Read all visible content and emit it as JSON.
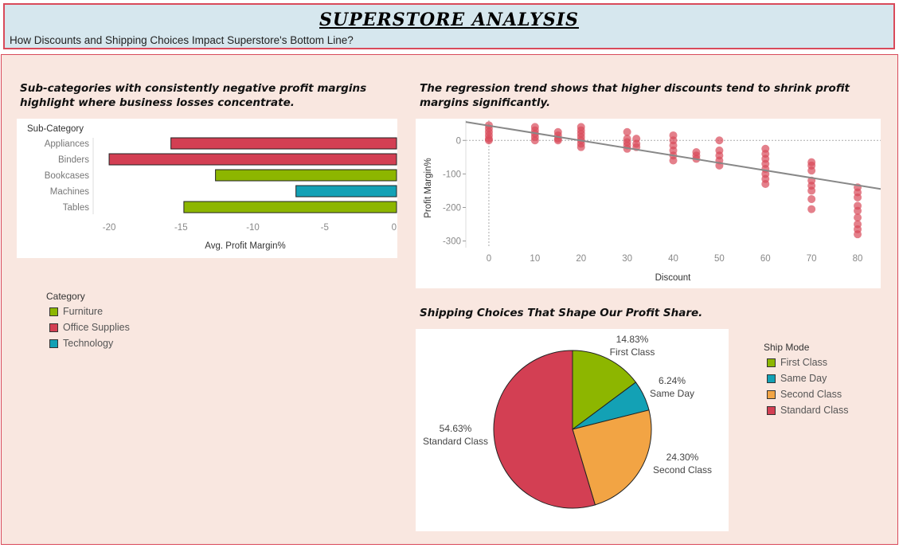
{
  "header": {
    "title": "SUPERSTORE ANALYSIS",
    "subtitle": "How Discounts and Shipping Choices Impact Superstore's Bottom Line?"
  },
  "captions": {
    "bar": "Sub-categories with consistently negative profit margins highlight where business losses concentrate.",
    "scatter": "The regression trend shows that higher discounts tend to shrink profit margins significantly.",
    "pie": "Shipping Choices That Shape Our Profit Share."
  },
  "category_legend": {
    "title": "Category",
    "items": [
      {
        "label": "Furniture",
        "color": "#8db600"
      },
      {
        "label": "Office Supplies",
        "color": "#d33f53"
      },
      {
        "label": "Technology",
        "color": "#13a1b5"
      }
    ]
  },
  "shipmode_legend": {
    "title": "Ship Mode",
    "items": [
      {
        "label": "First Class",
        "color": "#8db600"
      },
      {
        "label": "Same Day",
        "color": "#13a1b5"
      },
      {
        "label": "Second Class",
        "color": "#f2a444"
      },
      {
        "label": "Standard Class",
        "color": "#d33f53"
      }
    ]
  },
  "chart_data": [
    {
      "type": "bar",
      "orientation": "horizontal",
      "row_header": "Sub-Category",
      "categories": [
        "Appliances",
        "Binders",
        "Bookcases",
        "Machines",
        "Tables"
      ],
      "values": [
        -15.7,
        -20.0,
        -12.6,
        -7.0,
        -14.8
      ],
      "colors": [
        "#d33f53",
        "#d33f53",
        "#8db600",
        "#13a1b5",
        "#8db600"
      ],
      "xlabel": "Avg. Profit Margin%",
      "xlim": [
        -21,
        0
      ],
      "xticks": [
        -20,
        -15,
        -10,
        -5,
        0
      ]
    },
    {
      "type": "scatter",
      "xlabel": "Discount",
      "ylabel": "Profit Margin%",
      "xlim": [
        -5,
        85
      ],
      "ylim": [
        -320,
        60
      ],
      "xticks": [
        0,
        10,
        20,
        30,
        40,
        50,
        60,
        70,
        80
      ],
      "yticks": [
        0,
        -100,
        -200,
        -300
      ],
      "color": "#d94a5a",
      "points": [
        [
          0,
          45
        ],
        [
          0,
          35
        ],
        [
          0,
          25
        ],
        [
          0,
          15
        ],
        [
          0,
          5
        ],
        [
          0,
          0
        ],
        [
          10,
          40
        ],
        [
          10,
          30
        ],
        [
          10,
          20
        ],
        [
          10,
          10
        ],
        [
          10,
          0
        ],
        [
          15,
          25
        ],
        [
          15,
          15
        ],
        [
          15,
          5
        ],
        [
          15,
          0
        ],
        [
          20,
          40
        ],
        [
          20,
          30
        ],
        [
          20,
          20
        ],
        [
          20,
          10
        ],
        [
          20,
          0
        ],
        [
          20,
          -10
        ],
        [
          20,
          -20
        ],
        [
          30,
          25
        ],
        [
          30,
          5
        ],
        [
          30,
          -5
        ],
        [
          30,
          -15
        ],
        [
          30,
          -25
        ],
        [
          32,
          5
        ],
        [
          32,
          -10
        ],
        [
          32,
          -20
        ],
        [
          40,
          15
        ],
        [
          40,
          0
        ],
        [
          40,
          -15
        ],
        [
          40,
          -30
        ],
        [
          40,
          -45
        ],
        [
          40,
          -60
        ],
        [
          45,
          -35
        ],
        [
          45,
          -45
        ],
        [
          45,
          -55
        ],
        [
          50,
          0
        ],
        [
          50,
          -30
        ],
        [
          50,
          -45
        ],
        [
          50,
          -60
        ],
        [
          50,
          -75
        ],
        [
          60,
          -25
        ],
        [
          60,
          -40
        ],
        [
          60,
          -55
        ],
        [
          60,
          -70
        ],
        [
          60,
          -85
        ],
        [
          60,
          -100
        ],
        [
          60,
          -115
        ],
        [
          60,
          -130
        ],
        [
          70,
          -65
        ],
        [
          70,
          -75
        ],
        [
          70,
          -90
        ],
        [
          70,
          -120
        ],
        [
          70,
          -135
        ],
        [
          70,
          -150
        ],
        [
          70,
          -175
        ],
        [
          70,
          -205
        ],
        [
          80,
          -140
        ],
        [
          80,
          -155
        ],
        [
          80,
          -170
        ],
        [
          80,
          -195
        ],
        [
          80,
          -210
        ],
        [
          80,
          -230
        ],
        [
          80,
          -250
        ],
        [
          80,
          -265
        ],
        [
          80,
          -280
        ]
      ],
      "trend_line": {
        "x": [
          -5,
          85
        ],
        "y": [
          55,
          -145
        ]
      }
    },
    {
      "type": "pie",
      "categories": [
        "First Class",
        "Same Day",
        "Second Class",
        "Standard Class"
      ],
      "values": [
        14.83,
        6.24,
        24.3,
        54.63
      ],
      "labels": [
        "14.83%",
        "6.24%",
        "24.30%",
        "54.63%"
      ],
      "colors": [
        "#8db600",
        "#13a1b5",
        "#f2a444",
        "#d33f53"
      ]
    }
  ]
}
